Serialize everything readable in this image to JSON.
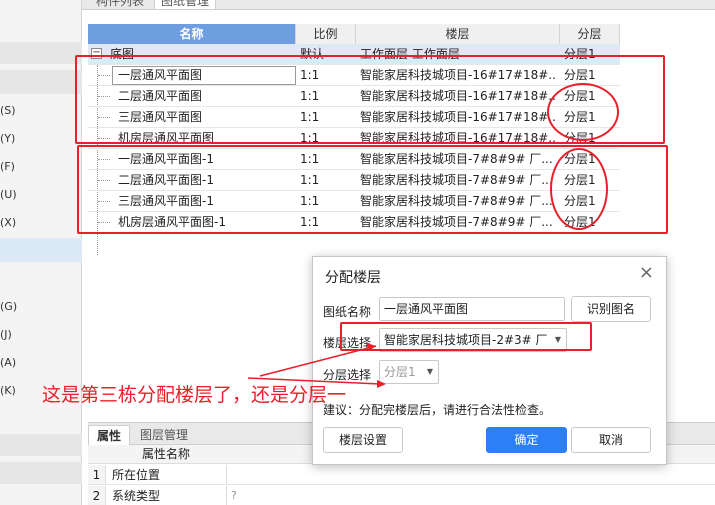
{
  "top_tabs": [
    {
      "label": "构件列表"
    },
    {
      "label": "图纸管理"
    }
  ],
  "left_shortcuts": [
    "(S)",
    "(Y)",
    "(F)",
    "(U)",
    "(X)",
    "(G)",
    "(J)",
    "(A)",
    "(K)"
  ],
  "table": {
    "headers": {
      "name": "名称",
      "scale": "比例",
      "floor": "楼层",
      "layer": "分层"
    },
    "base_row": {
      "expander": "−",
      "name": "底图",
      "scale": "默认",
      "floor": "工作面层 工作面层",
      "layer": "分层1"
    },
    "rows": [
      {
        "name": "一层通风平面图",
        "scale": "1:1",
        "floor": "智能家居科技城项目-16#17#18#...",
        "layer": "分层1"
      },
      {
        "name": "二层通风平面图",
        "scale": "1:1",
        "floor": "智能家居科技城项目-16#17#18#...",
        "layer": "分层1"
      },
      {
        "name": "三层通风平面图",
        "scale": "1:1",
        "floor": "智能家居科技城项目-16#17#18#...",
        "layer": "分层1"
      },
      {
        "name": "机房层通风平面图",
        "scale": "1:1",
        "floor": "智能家居科技城项目-16#17#18#...",
        "layer": "分层1"
      },
      {
        "name": "一层通风平面图-1",
        "scale": "1:1",
        "floor": "智能家居科技城项目-7#8#9# 厂...",
        "layer": "分层1"
      },
      {
        "name": "二层通风平面图-1",
        "scale": "1:1",
        "floor": "智能家居科技城项目-7#8#9# 厂...",
        "layer": "分层1"
      },
      {
        "name": "三层通风平面图-1",
        "scale": "1:1",
        "floor": "智能家居科技城项目-7#8#9# 厂...",
        "layer": "分层1"
      },
      {
        "name": "机房层通风平面图-1",
        "scale": "1:1",
        "floor": "智能家居科技城项目-7#8#9# 厂...",
        "layer": "分层1"
      }
    ]
  },
  "annotation": {
    "text": "这是第三栋分配楼层了，还是分层一",
    "color": "#e8202a"
  },
  "bottom_panel": {
    "tabs": [
      {
        "label": "属性"
      },
      {
        "label": "图层管理"
      }
    ],
    "header": "属性名称",
    "rows": [
      {
        "num": "1",
        "name": "所在位置",
        "extra": ""
      },
      {
        "num": "2",
        "name": "系统类型",
        "extra": "?"
      }
    ]
  },
  "dialog": {
    "title": "分配楼层",
    "close": "×",
    "drawing_name_label": "图纸名称",
    "drawing_name_value": "一层通风平面图",
    "identify_button": "识别图名",
    "floor_select_label": "楼层选择",
    "floor_select_value": "智能家居科技城项目-2#3# 厂",
    "layer_select_label": "分层选择",
    "layer_select_value": "分层1",
    "note": "建议：分配完楼层后，请进行合法性检查。",
    "floor_settings_button": "楼层设置",
    "ok_button": "确定",
    "cancel_button": "取消"
  },
  "colors": {
    "accent": "#2e7ff5",
    "annotation": "#e8202a",
    "header_selected": "#6e9de0"
  }
}
